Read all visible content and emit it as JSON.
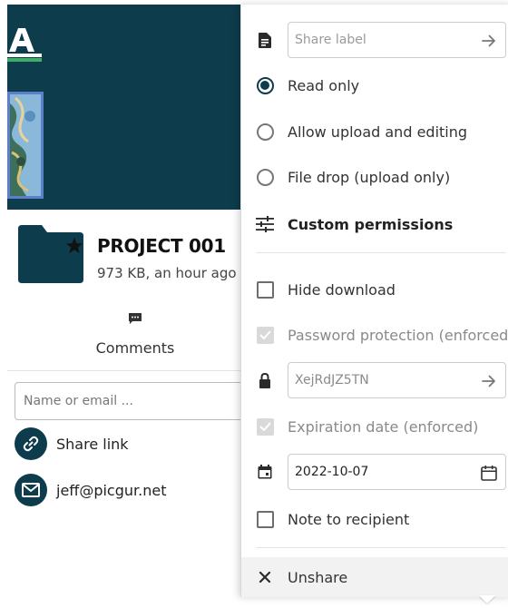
{
  "file": {
    "title": "PROJECT 001",
    "meta": "973 KB, an hour ago"
  },
  "tabs": {
    "comments": "Comments"
  },
  "search": {
    "placeholder": "Name or email ..."
  },
  "shares": [
    {
      "label": "Share link",
      "icon": "link-icon"
    },
    {
      "label": "jeff@picgur.net",
      "icon": "mail-icon"
    }
  ],
  "menu": {
    "share_label_placeholder": "Share label",
    "read_only": "Read only",
    "allow_upload_editing": "Allow upload and editing",
    "file_drop": "File drop (upload only)",
    "custom_permissions": "Custom permissions",
    "hide_download": "Hide download",
    "password_protection": "Password protection (enforced)",
    "password_value": "XejRdJZ5TN",
    "expiration_date": "Expiration date (enforced)",
    "date_value": "2022-10-07",
    "note_to_recipient": "Note to recipient",
    "unshare": "Unshare",
    "selected_permission": "read_only"
  },
  "colors": {
    "brand": "#0d3c4c",
    "disabled_text": "#8a8a8a",
    "unshare_bg": "#f2f2f2"
  }
}
